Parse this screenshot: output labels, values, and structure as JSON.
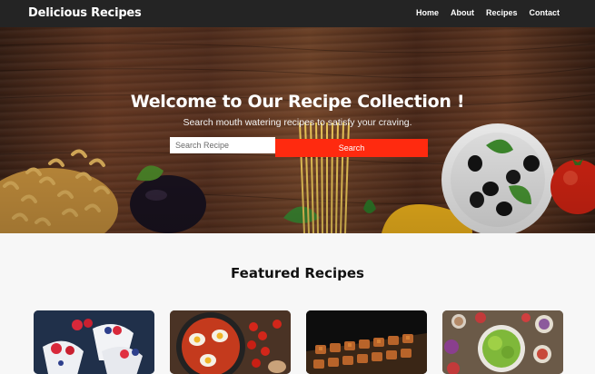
{
  "nav": {
    "brand": "Delicious Recipes",
    "links": [
      "Home",
      "About",
      "Recipes",
      "Contact"
    ]
  },
  "hero": {
    "title": "Welcome to Our Recipe Collection !",
    "subtitle": "Search mouth watering recipes to satisfy your craving.",
    "search_placeholder": "Search Recipe",
    "search_button": "Search"
  },
  "featured": {
    "title": "Featured Recipes",
    "cards": [
      {
        "image": "yogurt-berries-image"
      },
      {
        "image": "shakshuka-image"
      },
      {
        "image": "skewers-image"
      },
      {
        "image": "salad-ingredients-image"
      }
    ]
  },
  "colors": {
    "navbar": "#242424",
    "accent": "#ff2a0f",
    "page_bg": "#f7f7f7"
  }
}
